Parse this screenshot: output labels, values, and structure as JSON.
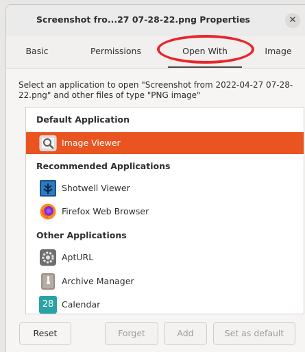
{
  "window": {
    "title": "Screenshot fro...27 07-28-22.png Properties",
    "close_glyph": "✕"
  },
  "tabs": [
    {
      "label": "Basic",
      "active": false
    },
    {
      "label": "Permissions",
      "active": false
    },
    {
      "label": "Open With",
      "active": true
    },
    {
      "label": "Image",
      "active": false
    }
  ],
  "annotation": {
    "shape": "ellipse",
    "color": "#e8262c",
    "target": "Open With"
  },
  "description": "Select an application to open \"Screenshot from 2022-04-27 07-28-22.png\" and other files of type \"PNG image\"",
  "app_list": {
    "default_header": "Default Application",
    "recommended_header": "Recommended Applications",
    "other_header": "Other Applications",
    "default_app": {
      "label": "Image Viewer",
      "icon": "image-viewer-icon",
      "selected": true
    },
    "recommended_apps": [
      {
        "label": "Shotwell Viewer",
        "icon": "shotwell-icon"
      },
      {
        "label": "Firefox Web Browser",
        "icon": "firefox-icon"
      }
    ],
    "other_apps": [
      {
        "label": "AptURL",
        "icon": "apturl-gear-icon"
      },
      {
        "label": "Archive Manager",
        "icon": "archive-manager-icon"
      },
      {
        "label": "Calendar",
        "icon": "calendar-icon",
        "icon_text": "28"
      }
    ]
  },
  "buttons": {
    "reset": "Reset",
    "forget": "Forget",
    "add": "Add",
    "set_default": "Set as default"
  },
  "colors": {
    "selection": "#e95420",
    "annotation": "#e8262c"
  }
}
